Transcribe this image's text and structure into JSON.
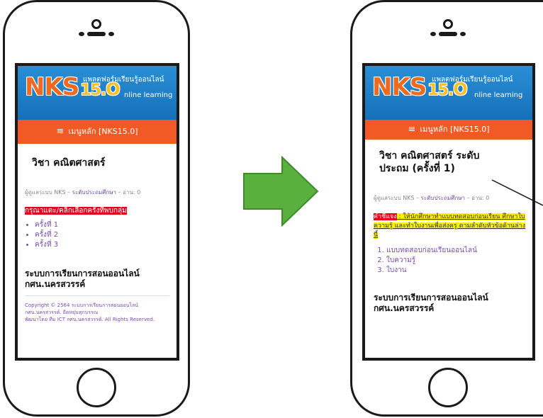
{
  "header": {
    "logo_main": "NKS",
    "logo_ver_num": "15.",
    "logo_ver_o": "O",
    "tagline_thai": "แพลตฟอร์มเรียนรู้ออนไลน์",
    "tagline_en": "nline learning"
  },
  "menu": {
    "bars": "≡",
    "label": "เมนูหลัก [NKS15.0]"
  },
  "left": {
    "title": "วิชา คณิตศาสตร์",
    "meta_author": "ผู้ดูแลระบบ NKS",
    "meta_sep": " – ",
    "meta_category": "ระดับประถมศึกษา",
    "meta_reads": " – อ่าน: 0",
    "notice": "กรุณาแตะ/คลิกเลือกครั้งที่พบกลุ่ม",
    "links": [
      "ครั้งที่ 1",
      "ครั้งที่ 2",
      "ครั้งที่ 3"
    ],
    "footer_title_1": "ระบบการเรียนการสอนออนไลน์",
    "footer_title_2": "กศน.นครสวรรค์",
    "copyright_1": "Copyright © 2564 ระบบการเรียนการสอนออนไลน์",
    "copyright_2": "กศน.นครสวรรค์. ยืดหยุ่นทุกบรรณ",
    "copyright_3": "พัฒนาโดย ทีม ICT กศน.นครสวรรค์. All Rights Reserved."
  },
  "right": {
    "title_1": "วิชา คณิตศาสตร์ ระดับ",
    "title_2": "ประถม (ครั้งที่ 1)",
    "meta_author": "ผู้ดูแลระบบ NKS",
    "meta_sep": " – ",
    "meta_category": "ระดับประถมศึกษา",
    "meta_reads": " – อ่าน: 0",
    "instr_label": "คำชี้แจง",
    "instr_text": " : ให้นักศึกษาทำแบบทดสอบก่อนเรียน ศึกษาใบความรู้ และทำใบงานเพื่อส่งครู ตามลำดับหัวข้อด้านล่างนี้",
    "links": [
      "แบบทดสอบก่อนเรียนออนไลน์",
      "ใบความรู้",
      "ใบงาน"
    ],
    "footer_title_1": "ระบบการเรียนการสอนออนไลน์",
    "footer_title_2": "กศน.นครสวรรค์"
  },
  "colors": {
    "banner_blue": "#1a7cc4",
    "menu_orange": "#f15a24",
    "arrow_green": "#5ab03c",
    "highlight_red": "#e3001b",
    "highlight_yellow": "#fff200",
    "link_purple": "#7a4cb0"
  },
  "icons": [
    "right-arrow-icon",
    "hamburger-menu-icon",
    "home-button-icon",
    "front-camera-icon"
  ]
}
